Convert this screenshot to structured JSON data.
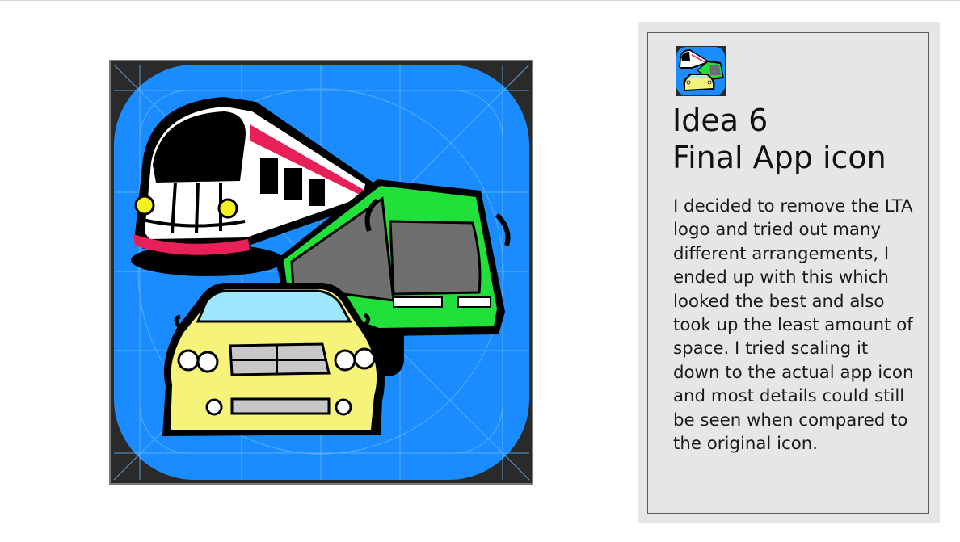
{
  "slide": {
    "title_line1": "Idea 6",
    "title_line2": "Final App icon",
    "body": "I decided to remove the LTA logo and tried out many different arrangements, I ended up with this which looked the best and also took up the least amount of space. I tried scaling it down to the actual app icon and most details could still be seen when compared to the original icon."
  },
  "colors": {
    "icon_background": "#1a8cff",
    "train_accent": "#e8205a",
    "bus_body": "#22e03a",
    "car_body": "#f6f37a",
    "panel_background": "#e6e6e6"
  }
}
